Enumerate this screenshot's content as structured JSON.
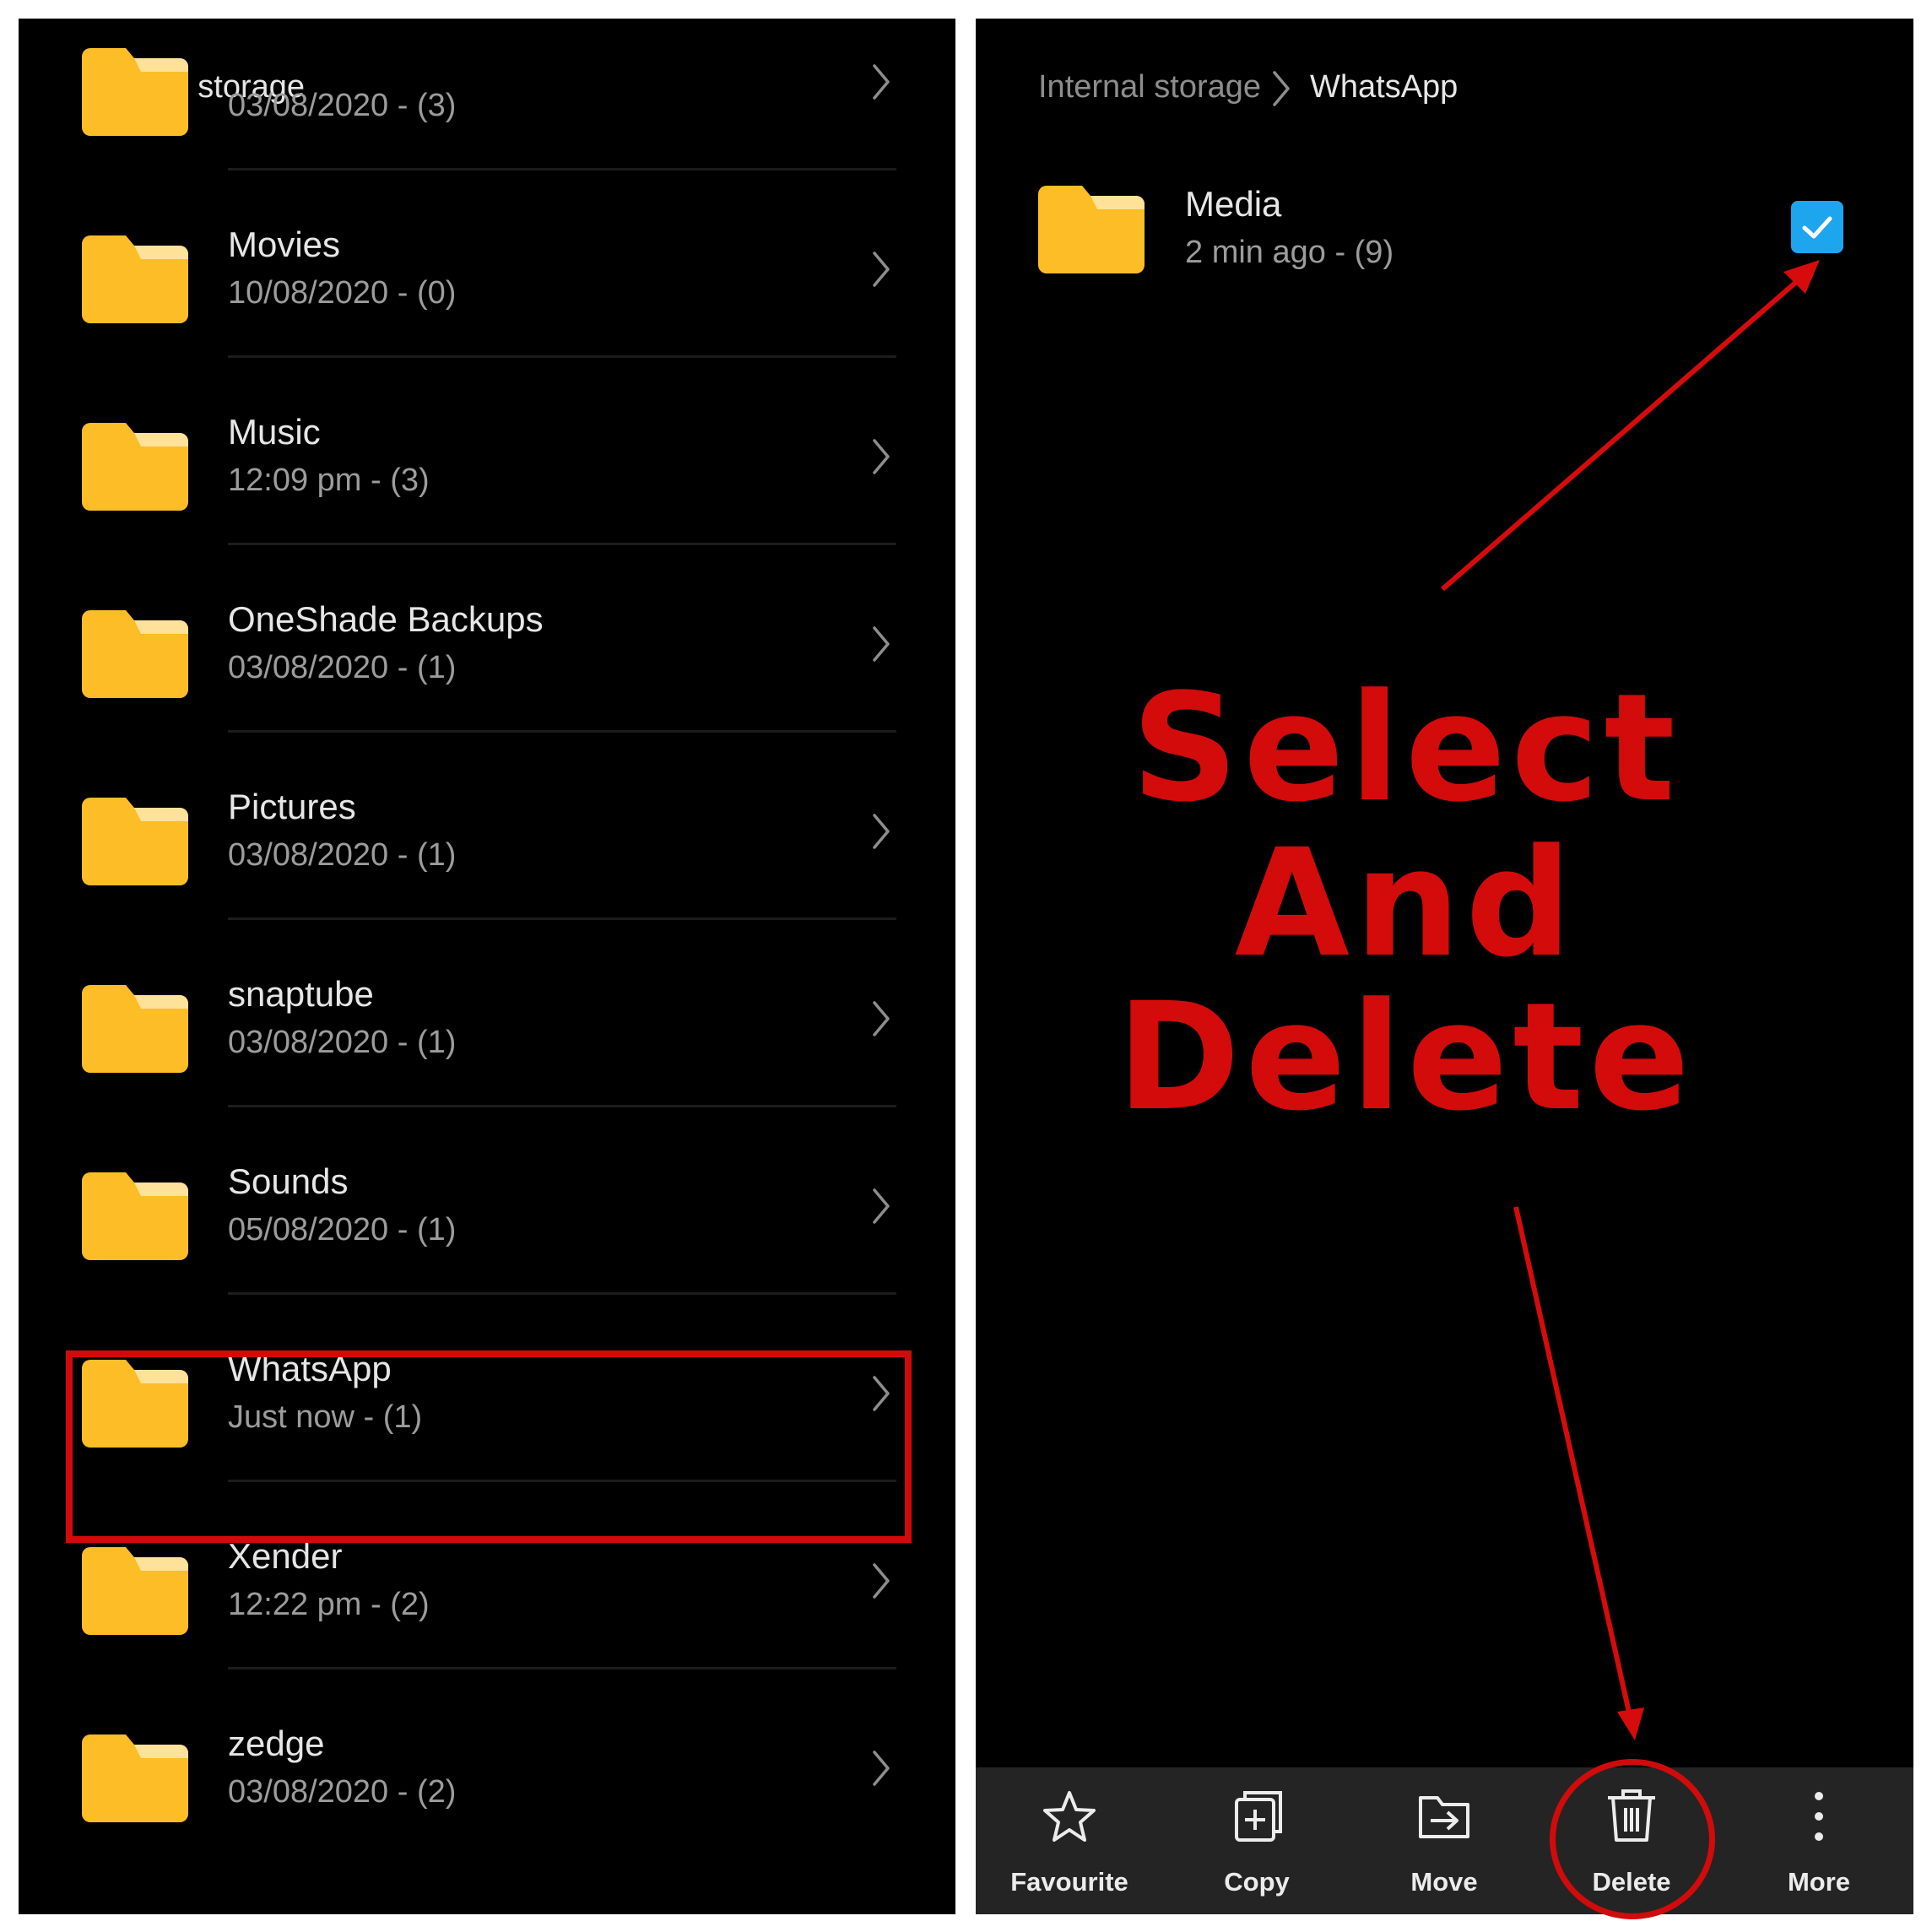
{
  "left_panel": {
    "title": "Internal storage",
    "folders": [
      {
        "name": "",
        "meta": "03/08/2020 - (3)"
      },
      {
        "name": "Movies",
        "meta": "10/08/2020 - (0)"
      },
      {
        "name": "Music",
        "meta": "12:09 pm - (3)"
      },
      {
        "name": "OneShade Backups",
        "meta": "03/08/2020 - (1)"
      },
      {
        "name": "Pictures",
        "meta": "03/08/2020 - (1)"
      },
      {
        "name": "snaptube",
        "meta": "03/08/2020 - (1)"
      },
      {
        "name": "Sounds",
        "meta": "05/08/2020 - (1)"
      },
      {
        "name": "WhatsApp",
        "meta": "Just now - (1)"
      },
      {
        "name": "Xender",
        "meta": "12:22 pm - (2)"
      },
      {
        "name": "zedge",
        "meta": "03/08/2020 - (2)"
      }
    ],
    "highlighted_folder": "WhatsApp"
  },
  "right_panel": {
    "breadcrumb": {
      "root": "Internal storage",
      "current": "WhatsApp"
    },
    "item": {
      "name": "Media",
      "meta": "2 min ago - (9)",
      "selected": true
    },
    "annotation": {
      "line1": "Select",
      "line2": "And",
      "line3": "Delete"
    },
    "toolbar": {
      "favourite": "Favourite",
      "copy": "Copy",
      "move": "Move",
      "delete": "Delete",
      "more": "More"
    }
  },
  "colors": {
    "background": "#000000",
    "folder": "#fcbd26",
    "folder_tab": "#ffe29a",
    "checkbox": "#1da5ee",
    "annotation_red": "#d30b0b",
    "toolbar_bg": "#242424"
  },
  "icons": [
    "folder-icon",
    "chevron-right-icon",
    "check-icon",
    "star-icon",
    "copy-icon",
    "move-icon",
    "trash-icon",
    "more-vertical-icon"
  ]
}
